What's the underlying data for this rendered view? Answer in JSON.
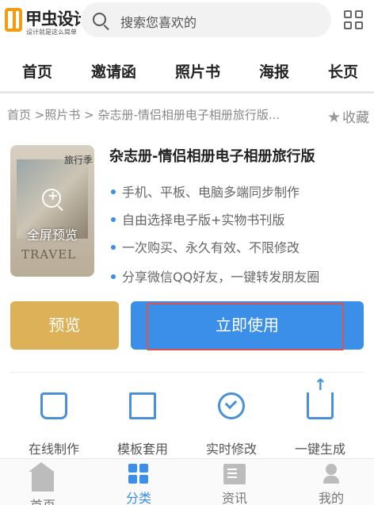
{
  "header": {
    "logo_name": "甲虫设计",
    "logo_slogan": "设计就是这么简单",
    "search_placeholder": "搜索您喜欢的"
  },
  "nav": [
    "首页",
    "邀请函",
    "照片书",
    "海报",
    "长页"
  ],
  "breadcrumb": "首页 >照片书 > 杂志册-情侣相册电子相册旅行版...",
  "collect_label": "收藏",
  "product": {
    "thumbnail_label": "全屏预览",
    "thumbnail_word": "TRAVEL",
    "thumbnail_cn": "旅行季",
    "title": "杂志册-情侣相册电子相册旅行版",
    "features": [
      "手机、平板、电脑多端同步制作",
      "自由选择电子版+实物书刊版",
      "一次购买、永久有效、不限修改",
      "分享微信QQ好友，一键转发朋友圈"
    ],
    "preview_button": "预览",
    "use_button": "立即使用"
  },
  "feature_row": [
    {
      "label": "在线制作",
      "icon": "thumbs-up-icon"
    },
    {
      "label": "模板套用",
      "icon": "folder-icon"
    },
    {
      "label": "实时修改",
      "icon": "check-circle-icon"
    },
    {
      "label": "一键生成",
      "icon": "upload-icon"
    }
  ],
  "tabbar": [
    {
      "label": "首页",
      "icon": "home-icon",
      "active": false
    },
    {
      "label": "分类",
      "icon": "category-icon",
      "active": true
    },
    {
      "label": "资讯",
      "icon": "news-icon",
      "active": false
    },
    {
      "label": "我的",
      "icon": "user-icon",
      "active": false
    }
  ],
  "colors": {
    "accent": "#3b8fe8",
    "preview_button": "#dcb157",
    "highlight_outline": "#d9534f"
  }
}
